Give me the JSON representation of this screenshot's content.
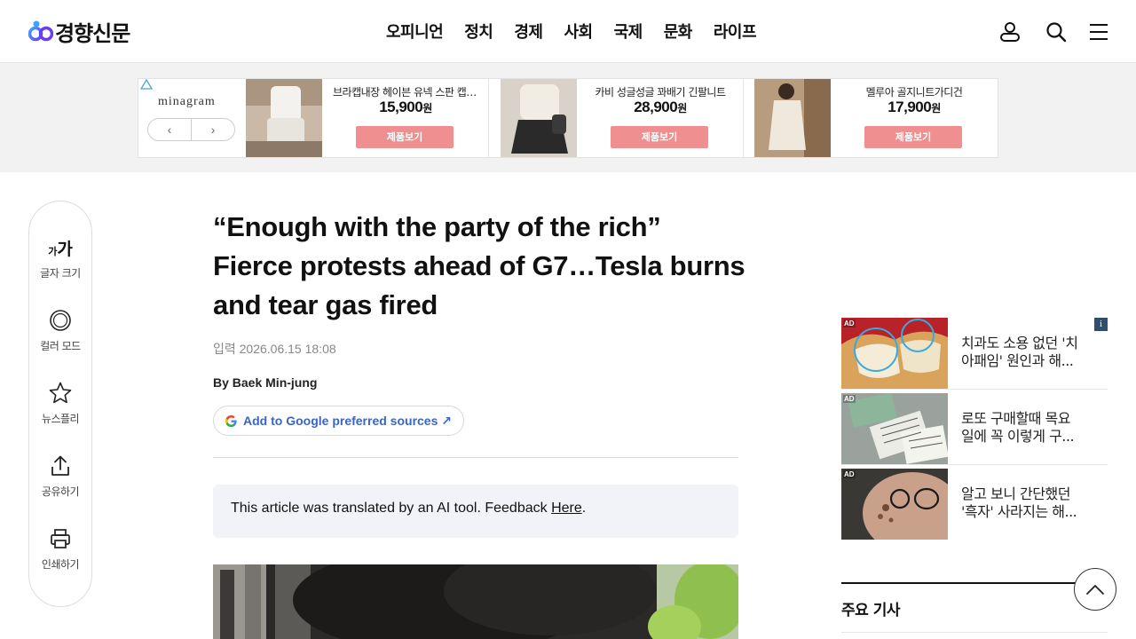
{
  "brand": {
    "logo_text": "경향신문",
    "logo_icon": "infinity-logo-icon"
  },
  "nav": {
    "items": [
      "오피니언",
      "정치",
      "경제",
      "사회",
      "국제",
      "문화",
      "라이프"
    ]
  },
  "header_icons": [
    "user-icon",
    "search-icon",
    "menu-icon"
  ],
  "ad_banner": {
    "brand_name": "minagram",
    "prev_icon": "chevron-left-icon",
    "next_icon": "chevron-right-icon",
    "products": [
      {
        "name": "브라캡내장 헤이븐 유넥 스판 캡나시",
        "price": "15,900",
        "unit": "원",
        "button": "제품보기"
      },
      {
        "name": "카비 성글성글 꽈배기 긴팔니트",
        "price": "28,900",
        "unit": "원",
        "button": "제품보기"
      },
      {
        "name": "멜루아 골지니트가디건",
        "price": "17,900",
        "unit": "원",
        "button": "제품보기"
      }
    ]
  },
  "toolbar": {
    "font_size": {
      "small": "가",
      "large": "가",
      "label": "글자 크기"
    },
    "color_mode": "컬러 모드",
    "news_free": "뉴스플리",
    "share": "공유하기",
    "print": "인쇄하기"
  },
  "article": {
    "headline": "“Enough with the party of the rich” Fierce protests ahead of G7…Tesla burns and tear gas fired",
    "dateline": "입력 2026.06.15 18:08",
    "byline": "By Baek Min-jung",
    "google_button": "Add to Google preferred sources ↗",
    "ai_note": "This article was translated by an AI tool. Feedback ",
    "ai_note_link": "Here",
    "ai_note_end": "."
  },
  "right_ads": {
    "info_badge": "i",
    "items": [
      {
        "tag": "AD",
        "line1": "치과도 소용 없던 '치",
        "line2": "아패임' 원인과 해..."
      },
      {
        "tag": "AD",
        "line1": "로또 구매할때 목요",
        "line2": "일에 꼭 이렇게 구..."
      },
      {
        "tag": "AD",
        "line1": "알고 보니 간단했던",
        "line2": "'흑자' 사라지는 해..."
      }
    ]
  },
  "top_news": {
    "title": "주요 기사"
  },
  "scroll_top_icon": "chevron-up-icon"
}
